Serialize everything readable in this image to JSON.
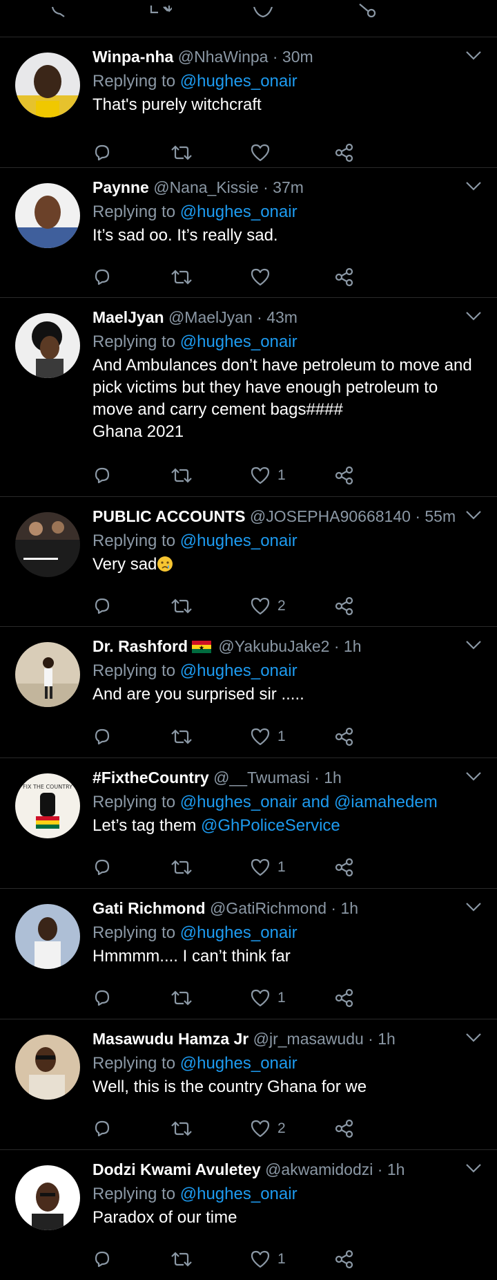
{
  "colors": {
    "background": "#000000",
    "divider": "#2a2a2a",
    "muted": "#8b98a5",
    "accent": "#1d9bf0",
    "text": "#ffffff"
  },
  "top_actions": {
    "icons": [
      "reply-icon",
      "retweet-icon",
      "like-icon",
      "share-icon"
    ]
  },
  "tweets": [
    {
      "display_name": "Winpa-nha",
      "handle": "@NhaWinpa",
      "dot": "·",
      "time": "30m",
      "replying_prefix": "Replying to ",
      "replying_to": "@hughes_onair",
      "text": "That's purely witchcraft",
      "likes": ""
    },
    {
      "display_name": "Paynne",
      "handle": "@Nana_Kissie",
      "dot": "·",
      "time": "37m",
      "replying_prefix": "Replying to ",
      "replying_to": "@hughes_onair",
      "text": "It’s sad oo. It’s really sad.",
      "likes": ""
    },
    {
      "display_name": "MaelJyan",
      "handle": "@MaelJyan",
      "dot": "·",
      "time": "43m",
      "replying_prefix": "Replying to ",
      "replying_to": "@hughes_onair",
      "text_lines": [
        "And Ambulances don’t have petroleum to move and",
        "pick victims but they have enough petroleum to",
        "move and carry cement bags####",
        "Ghana 2021"
      ],
      "likes": "1"
    },
    {
      "display_name": "PUBLIC ACCOUNTS",
      "handle": "@JOSEPHA90668140",
      "dot": "·",
      "time": "55m",
      "replying_prefix": "Replying to ",
      "replying_to": "@hughes_onair",
      "text": "Very sad",
      "likes": "2"
    },
    {
      "display_name": "Dr. Rashford",
      "handle": "@YakubuJake2",
      "dot": "·",
      "time": "1h",
      "replying_prefix": "Replying to ",
      "replying_to": "@hughes_onair",
      "text": "And are you surprised sir .....",
      "likes": "1"
    },
    {
      "display_name": "#FixtheCountry",
      "handle": "@__Twumasi",
      "dot": "·",
      "time": "1h",
      "replying_prefix": "Replying to ",
      "replying_to": "@hughes_onair and @iamahedem",
      "text_prefix": "Let’s tag them ",
      "text_mention": "@GhPoliceService",
      "avatar_text": "FIX THE COUNTRY",
      "likes": "1"
    },
    {
      "display_name": "Gati Richmond",
      "handle": "@GatiRichmond",
      "dot": "·",
      "time": "1h",
      "replying_prefix": "Replying to ",
      "replying_to": "@hughes_onair",
      "text": "Hmmmm.... I can’t think far",
      "likes": "1"
    },
    {
      "display_name": "Masawudu Hamza Jr",
      "handle": "@jr_masawudu",
      "dot": "·",
      "time": "1h",
      "replying_prefix": "Replying to ",
      "replying_to": "@hughes_onair",
      "text": "Well, this is the country Ghana for we",
      "likes": "2"
    },
    {
      "display_name": "Dodzi Kwami Avuletey",
      "handle": "@akwamidodzi",
      "dot": "·",
      "time": "1h",
      "replying_prefix": "Replying to ",
      "replying_to": "@hughes_onair",
      "text": "Paradox of our time",
      "likes": "1"
    }
  ]
}
